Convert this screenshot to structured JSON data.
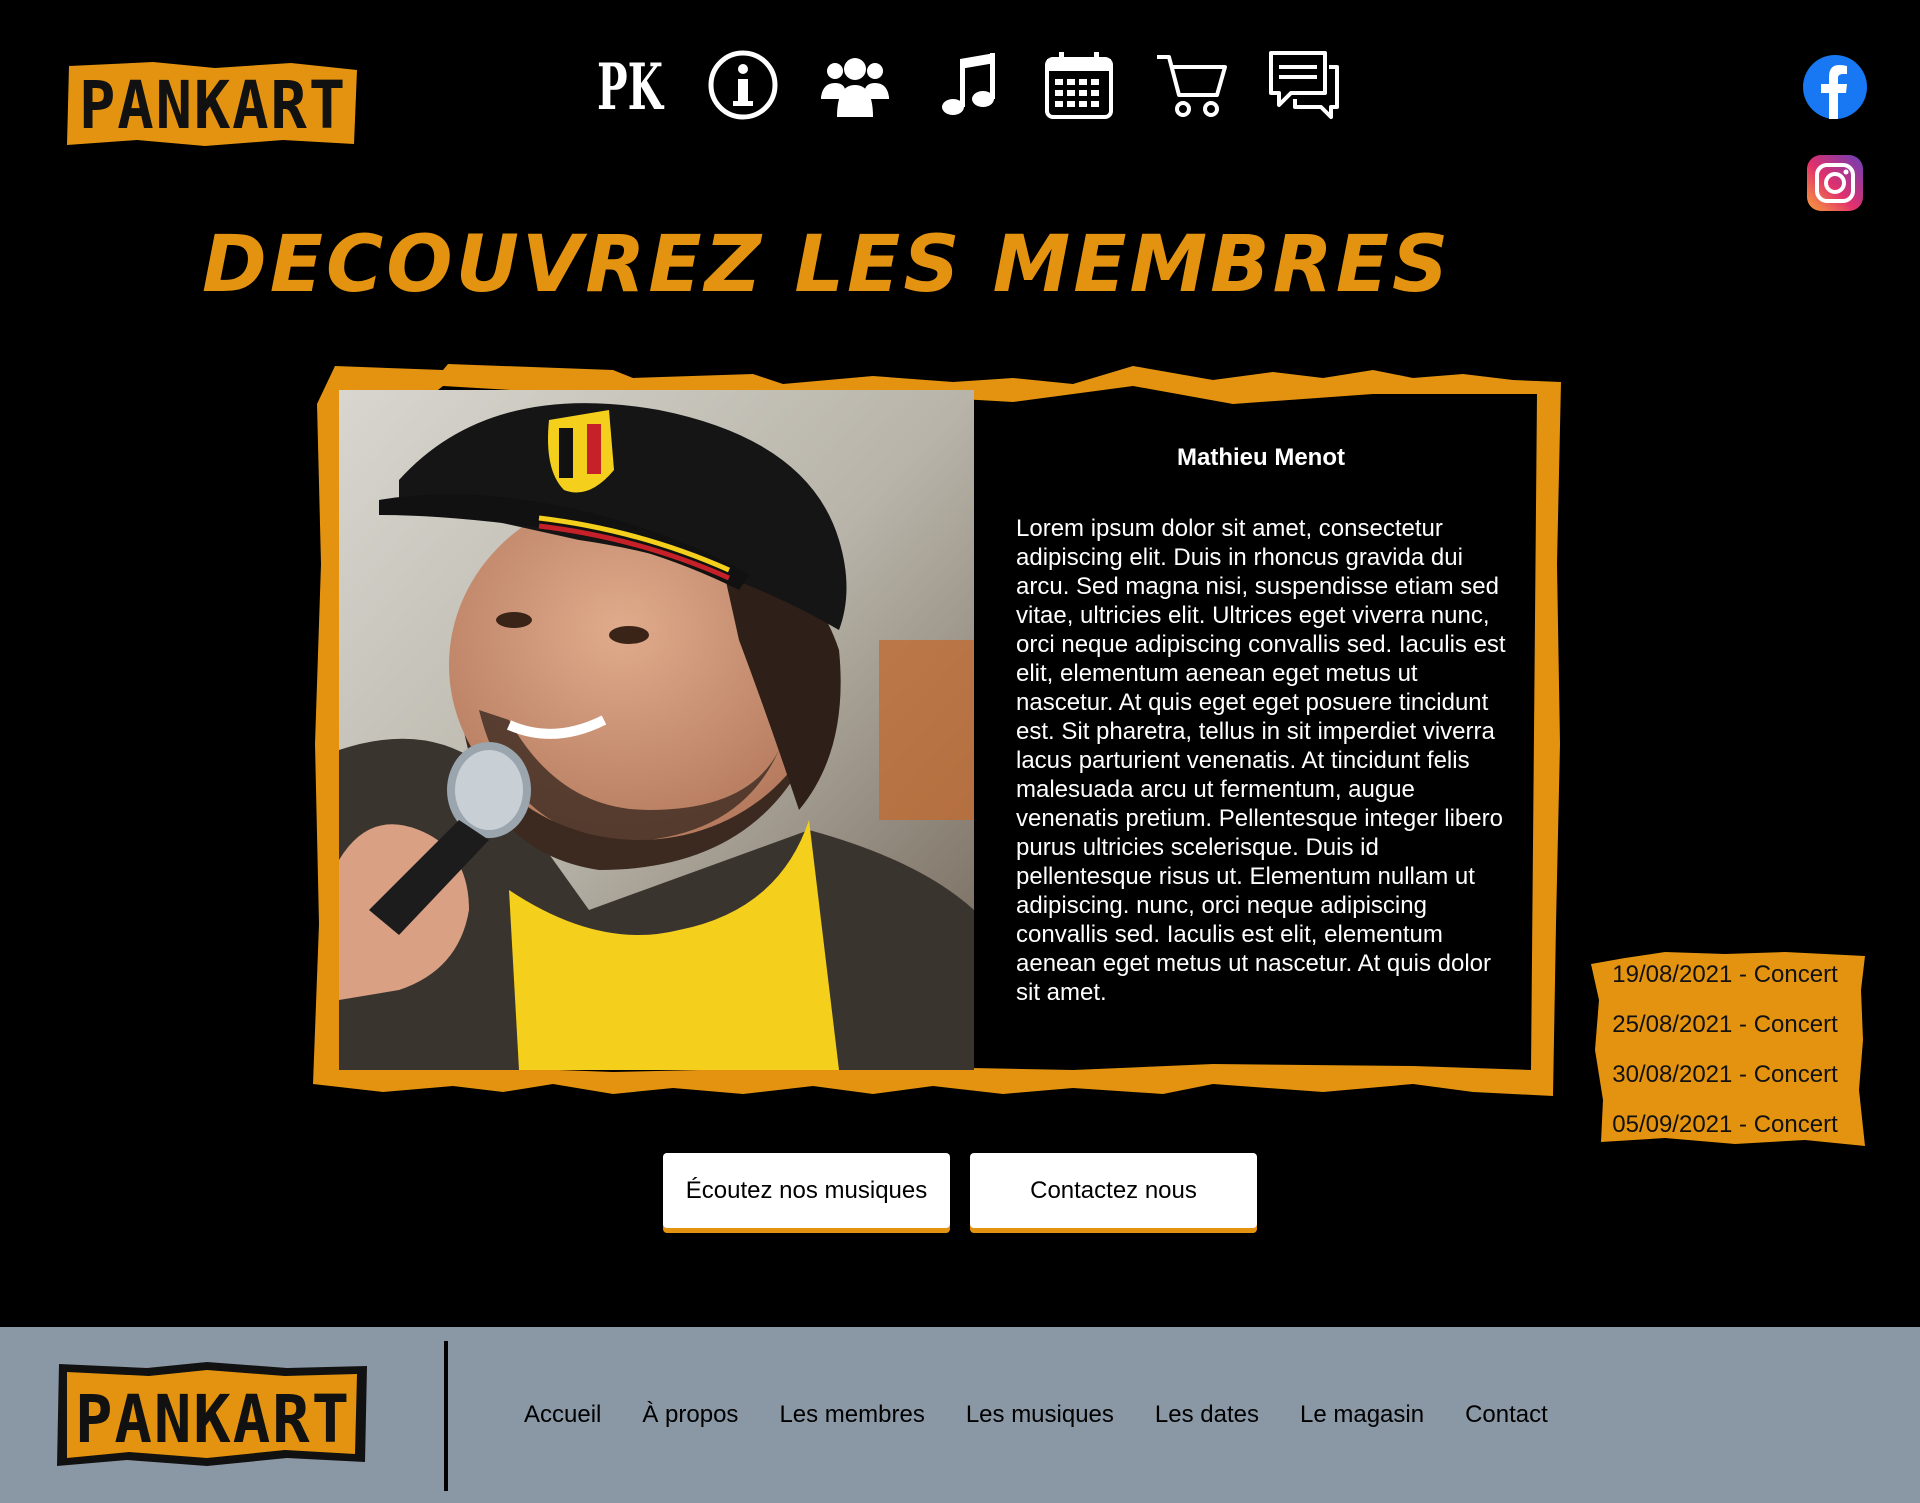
{
  "brand": {
    "logo_text": "PANKART"
  },
  "header": {
    "nav_icons": [
      {
        "icon": "pk-monogram-icon",
        "text": "PK"
      },
      {
        "icon": "info-icon"
      },
      {
        "icon": "members-group-icon"
      },
      {
        "icon": "music-note-icon"
      },
      {
        "icon": "calendar-icon"
      },
      {
        "icon": "shopping-cart-icon"
      },
      {
        "icon": "chat-bubble-icon"
      }
    ],
    "social": [
      {
        "icon": "facebook-icon"
      },
      {
        "icon": "instagram-icon"
      }
    ]
  },
  "main": {
    "title": "DECOUVREZ LES MEMBRES",
    "member": {
      "name": "Mathieu Menot",
      "bio": "Lorem ipsum dolor sit amet, consectetur adipiscing elit. Duis in rhoncus gravida dui arcu. Sed magna nisi, suspendisse etiam sed vitae, ultricies elit. Ultrices eget viverra nunc, orci neque adipiscing convallis sed. Iaculis est elit, elementum aenean eget metus ut nascetur. At quis eget eget posuere tincidunt est. Sit pharetra, tellus in sit imperdiet viverra lacus parturient venenatis. At tincidunt felis malesuada arcu ut fermentum, augue venenatis pretium. Pellentesque integer libero purus ultricies scelerisque. Duis id pellentesque risus ut. Elementum nullam ut adipiscing. nunc, orci neque adipiscing convallis sed. Iaculis est elit, elementum aenean eget metus ut nascetur. At quis dolor sit amet."
    },
    "dates": [
      "19/08/2021 - Concert",
      "25/08/2021 - Concert",
      "30/08/2021 - Concert",
      "05/09/2021 - Concert"
    ],
    "buttons": {
      "listen": "Écoutez nos musiques",
      "contact": "Contactez nous"
    }
  },
  "footer": {
    "links": [
      "Accueil",
      "À propos",
      "Les membres",
      "Les musiques",
      "Les dates",
      "Le magasin",
      "Contact"
    ]
  },
  "colors": {
    "accent": "#e3930f",
    "background": "#000000",
    "footer_bg": "#8a97a5",
    "facebook": "#1877f2"
  }
}
